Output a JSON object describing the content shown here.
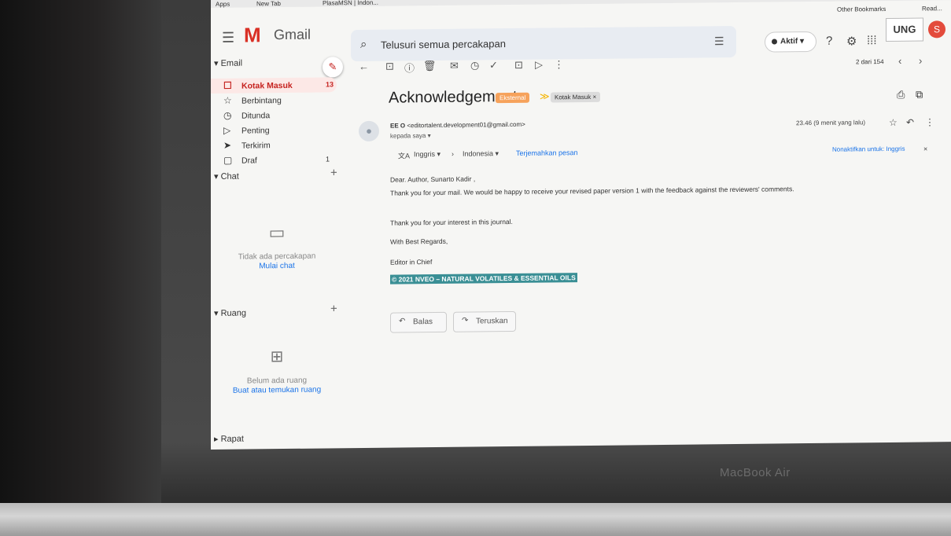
{
  "bookmarks": {
    "apps": "Apps",
    "new_tab": "New Tab",
    "plasa": "PlasaMSN | Indon...",
    "other": "Other Bookmarks",
    "reading": "Read..."
  },
  "header": {
    "app_name": "Gmail",
    "search_placeholder": "Telusuri semua percakapan",
    "status": "Aktif",
    "status_caret": "▾",
    "org_logo_text": "UNG",
    "avatar_letter": "S"
  },
  "sidebar": {
    "email_section": "Email",
    "items": [
      {
        "label": "Kotak Masuk",
        "count": "13",
        "icon": "inbox-icon"
      },
      {
        "label": "Berbintang",
        "count": "",
        "icon": "star-icon"
      },
      {
        "label": "Ditunda",
        "count": "",
        "icon": "clock-icon"
      },
      {
        "label": "Penting",
        "count": "",
        "icon": "important-icon"
      },
      {
        "label": "Terkirim",
        "count": "",
        "icon": "sent-icon"
      },
      {
        "label": "Draf",
        "count": "1",
        "icon": "draft-icon"
      }
    ],
    "chat_section": "Chat",
    "chat_empty": "Tidak ada percakapan",
    "chat_start": "Mulai chat",
    "space_section": "Ruang",
    "space_empty": "Belum ada ruang",
    "space_find": "Buat atau temukan ruang",
    "meet_section": "Rapat"
  },
  "toolbar": {
    "pager": "2 dari 154"
  },
  "message": {
    "subject": "Acknowledgement",
    "label_external": "Eksternal",
    "label_inbox": "Kotak Masuk ×",
    "sender_name": "EE O",
    "sender_email": "<editortalent.development01@gmail.com>",
    "to": "kepada saya ▾",
    "time": "23.46 (9 menit yang lalu)",
    "translate_from": "Inggris ▾",
    "translate_to": "Indonesia ▾",
    "translate_link": "Terjemahkan pesan",
    "translate_off": "Nonaktifkan untuk: Inggris",
    "body": {
      "greeting": "Dear. Author,  Sunarto Kadir ,",
      "line1": "Thank you for your mail. We would be happy to receive your revised paper version 1 with the feedback against the reviewers' comments.",
      "line2": "Thank you for your interest in this journal.",
      "regards": "With Best Regards,",
      "signature": "Editor in Chief",
      "footer": "© 2021 NVEO – NATURAL VOLATILES & ESSENTIAL OILS"
    },
    "reply": "Balas",
    "forward": "Teruskan"
  },
  "device": {
    "bezel_label": "MacBook Air"
  },
  "colors": {
    "gmail_red": "#d93025",
    "active_bg": "#fce8e6",
    "external_tag": "#f6a25b",
    "highlight": "#3a8f95",
    "link_blue": "#1a73e8"
  }
}
